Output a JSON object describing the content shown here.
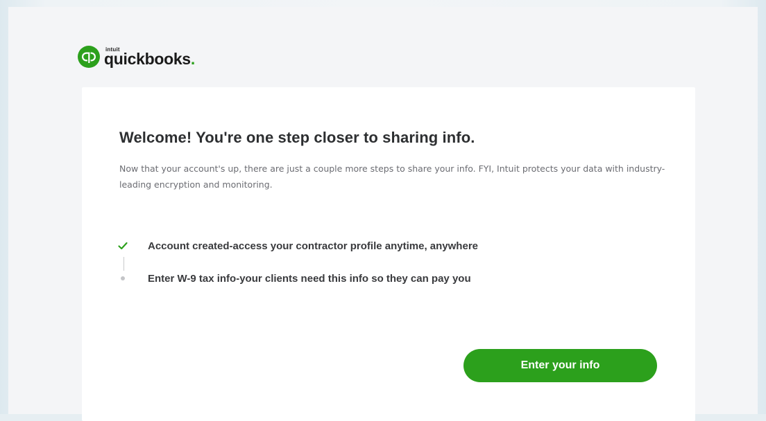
{
  "brand": {
    "company": "intuit",
    "product": "quickbooks",
    "logo_icon": "quickbooks-logo-icon",
    "accent_color": "#2ca01c"
  },
  "card": {
    "title": "Welcome! You're one step closer to sharing info.",
    "description": "Now that your account's up, there are just a couple more steps to share your info. FYI, Intuit protects your data with industry-leading encryption and monitoring.",
    "steps": [
      {
        "label": "Account created-access your contractor profile anytime, anywhere",
        "status": "complete",
        "icon": "checkmark-icon"
      },
      {
        "label": "Enter W-9 tax info-your clients need this info so they can pay you",
        "status": "pending",
        "icon": "dot-icon"
      }
    ],
    "button_label": "Enter your info"
  }
}
